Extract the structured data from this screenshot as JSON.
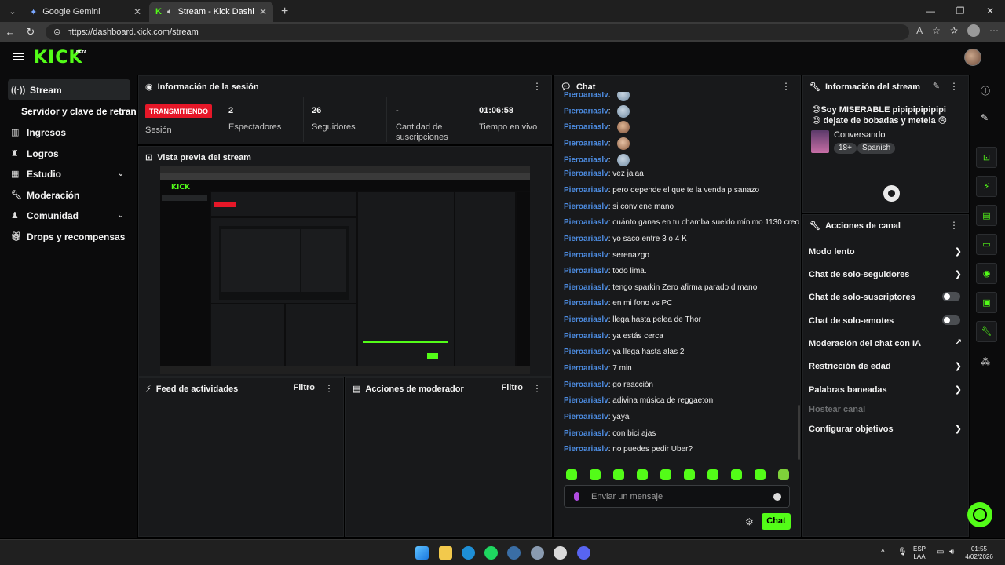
{
  "browser": {
    "tabs": [
      {
        "title": "Google Gemini",
        "active": false
      },
      {
        "title": "Stream - Kick Dashboard",
        "active": true
      }
    ],
    "url": "https://dashboard.kick.com/stream"
  },
  "kick": {
    "logo": "KICK",
    "beta": "BETA"
  },
  "sidebar": {
    "items": [
      {
        "label": "Stream",
        "icon": "broadcast-icon"
      },
      {
        "label": "Servidor y clave de retransmisión",
        "icon": ""
      },
      {
        "label": "Ingresos",
        "icon": "chart-icon"
      },
      {
        "label": "Logros",
        "icon": "trophy-icon"
      },
      {
        "label": "Estudio",
        "icon": "studio-icon"
      },
      {
        "label": "Moderación",
        "icon": "wrench-icon"
      },
      {
        "label": "Comunidad",
        "icon": "community-icon"
      },
      {
        "label": "Drops y recompensas",
        "icon": "gift-icon"
      }
    ]
  },
  "session": {
    "title": "Información de la sesión",
    "status_badge": "TRANSMITIENDO",
    "stats": [
      {
        "label": "Sesión",
        "value": ""
      },
      {
        "label": "Espectadores",
        "value": "2"
      },
      {
        "label": "Seguidores",
        "value": "26"
      },
      {
        "label": "Cantidad de suscripciones",
        "value": "-"
      },
      {
        "label": "Tiempo en vivo",
        "value": "01:06:58"
      }
    ]
  },
  "preview": {
    "title": "Vista previa del stream"
  },
  "activity": {
    "title": "Feed de actividades",
    "filter": "Filtro"
  },
  "modactions": {
    "title": "Acciones de moderador",
    "filter": "Filtro"
  },
  "chat": {
    "title": "Chat",
    "messages": [
      {
        "user": "Pieroariaslv",
        "text": "",
        "emote": true
      },
      {
        "user": "Pieroariaslv",
        "text": "",
        "emote": true
      },
      {
        "user": "Pieroariaslv",
        "text": "",
        "emote": true
      },
      {
        "user": "Pieroariaslv",
        "text": "",
        "emote": true
      },
      {
        "user": "Pieroariaslv",
        "text": "",
        "emote": true
      },
      {
        "user": "Pieroariaslv",
        "text": "vez jajaa"
      },
      {
        "user": "Pieroariaslv",
        "text": "pero depende el que te la venda p sanazo"
      },
      {
        "user": "Pieroariaslv",
        "text": "si conviene mano"
      },
      {
        "user": "Pieroariaslv",
        "text": "cuánto ganas en tu chamba sueldo mínimo 1130 creo"
      },
      {
        "user": "Pieroariaslv",
        "text": "yo saco entre 3 o 4 K"
      },
      {
        "user": "Pieroariaslv",
        "text": "serenazgo"
      },
      {
        "user": "Pieroariaslv",
        "text": "todo lima."
      },
      {
        "user": "Pieroariaslv",
        "text": "tengo sparkin Zero afirma parado d mano"
      },
      {
        "user": "Pieroariaslv",
        "text": "en mi fono vs PC"
      },
      {
        "user": "Pieroariaslv",
        "text": "llega hasta pelea de Thor"
      },
      {
        "user": "Pieroariaslv",
        "text": "ya estás cerca"
      },
      {
        "user": "Pieroariaslv",
        "text": "ya llega hasta alas 2"
      },
      {
        "user": "Pieroariaslv",
        "text": "7 min"
      },
      {
        "user": "Pieroariaslv",
        "text": "go reacción"
      },
      {
        "user": "Pieroariaslv",
        "text": "adivina música de reggaeton"
      },
      {
        "user": "Pieroariaslv",
        "text": "yaya"
      },
      {
        "user": "Pieroariaslv",
        "text": "con bici ajas"
      },
      {
        "user": "Pieroariaslv",
        "text": "no puedes pedir Uber?"
      }
    ],
    "input_placeholder": "Enviar un mensaje",
    "send_label": "Chat",
    "emote_count": 10
  },
  "stream_info": {
    "title": "Información del stream",
    "stream_title": "😓Soy MISERABLE pipipipipipipi😓 dejate de bobadas y metela 😨",
    "category": "Conversando",
    "tags": [
      "18+",
      "Spanish"
    ]
  },
  "channel_actions": {
    "title": "Acciones de canal",
    "items": [
      {
        "label": "Modo lento",
        "type": "chevron"
      },
      {
        "label": "Chat de solo-seguidores",
        "type": "chevron"
      },
      {
        "label": "Chat de solo-suscriptores",
        "type": "toggle"
      },
      {
        "label": "Chat de solo-emotes",
        "type": "toggle"
      },
      {
        "label": "Moderación del chat con IA",
        "type": "external"
      },
      {
        "label": "Restricción de edad",
        "type": "chevron"
      },
      {
        "label": "Palabras baneadas",
        "type": "chevron"
      },
      {
        "label": "Hostear canal",
        "type": "disabled"
      },
      {
        "label": "Configurar objetivos",
        "type": "chevron"
      }
    ]
  },
  "taskbar": {
    "lang_top": "ESP",
    "lang_bottom": "LAA",
    "time": "01:55",
    "date": "4/02/2026"
  },
  "colors": {
    "accent": "#53fc18",
    "live": "#e61728",
    "username": "#4d8de3",
    "panel": "#18191b"
  }
}
